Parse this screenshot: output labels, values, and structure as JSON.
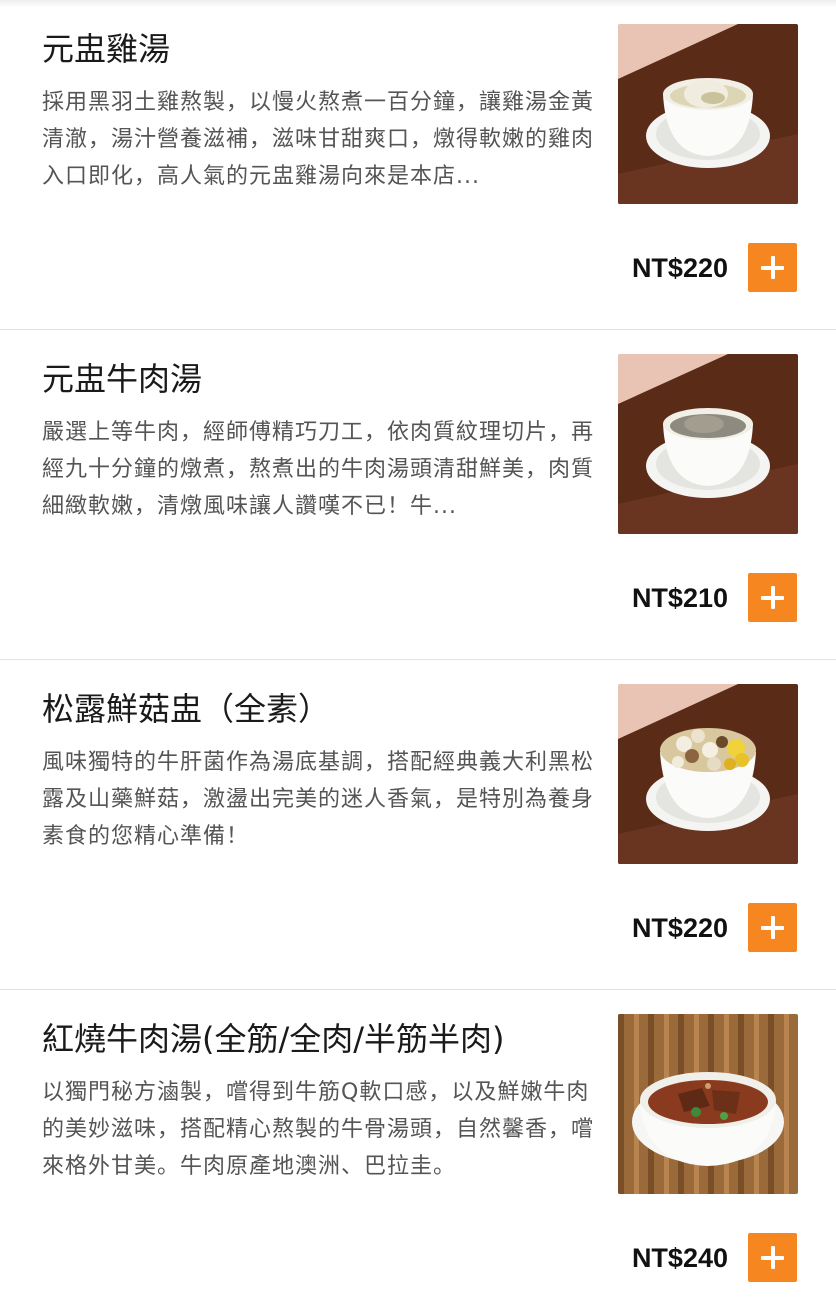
{
  "colors": {
    "accent": "#f6861f",
    "divider": "#e2e2e2",
    "description_text": "#555555"
  },
  "menu": {
    "items": [
      {
        "name": "元盅雞湯",
        "description": "採用黑羽土雞熬製，以慢火熬煮一百分鐘，讓雞湯金黃清澈，湯汁營養滋補，滋味甘甜爽口，燉得軟嫩的雞肉入口即化，高人氣的元盅雞湯向來是本店...",
        "price": "NT$220",
        "image_icon": "chicken-soup-photo"
      },
      {
        "name": "元盅牛肉湯",
        "description": "嚴選上等牛肉，經師傅精巧刀工，依肉質紋理切片，再經九十分鐘的燉煮，熬煮出的牛肉湯頭清甜鮮美，肉質細緻軟嫩，清燉風味讓人讚嘆不已！牛...",
        "price": "NT$210",
        "image_icon": "beef-soup-photo"
      },
      {
        "name": "松露鮮菇盅（全素）",
        "description": "風味獨特的牛肝菌作為湯底基調，搭配經典義大利黑松露及山藥鮮菇，激盪出完美的迷人香氣，是特別為養身素食的您精心準備！",
        "price": "NT$220",
        "image_icon": "mushroom-soup-photo"
      },
      {
        "name": "紅燒牛肉湯(全筋/全肉/半筋半肉)",
        "description": "以獨門秘方滷製，嚐得到牛筋Q軟口感，以及鮮嫩牛肉的美妙滋味，搭配精心熬製的牛骨湯頭，自然馨香，嚐來格外甘美。牛肉原產地澳洲、巴拉圭。",
        "price": "NT$240",
        "image_icon": "braised-beef-soup-photo"
      }
    ]
  }
}
